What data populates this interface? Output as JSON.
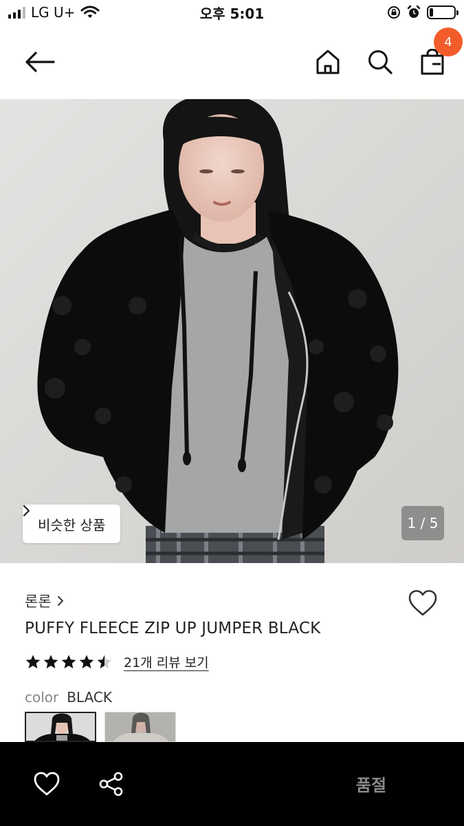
{
  "status_bar": {
    "carrier": "LG U+",
    "time": "오후 5:01",
    "battery_level": 0.15
  },
  "header": {
    "cart_count": "4"
  },
  "hero": {
    "similar_label": "비슷한 상품",
    "page_indicator": "1 / 5"
  },
  "product": {
    "brand": "론론",
    "name": "PUFFY FLEECE ZIP UP JUMPER BLACK",
    "rating": 4.5,
    "review_link": "21개 리뷰 보기",
    "color_label": "color",
    "color_value": "BLACK"
  },
  "bottom_bar": {
    "buy_label": "품절"
  },
  "icons": [
    "back-arrow-icon",
    "home-icon",
    "search-icon",
    "cart-icon",
    "heart-icon",
    "share-icon",
    "chevron-right-icon",
    "star-icon"
  ],
  "colors": {
    "badge": "#f25c2a",
    "bottom_bar": "#000000",
    "soldout_text": "#8a8a8a"
  }
}
